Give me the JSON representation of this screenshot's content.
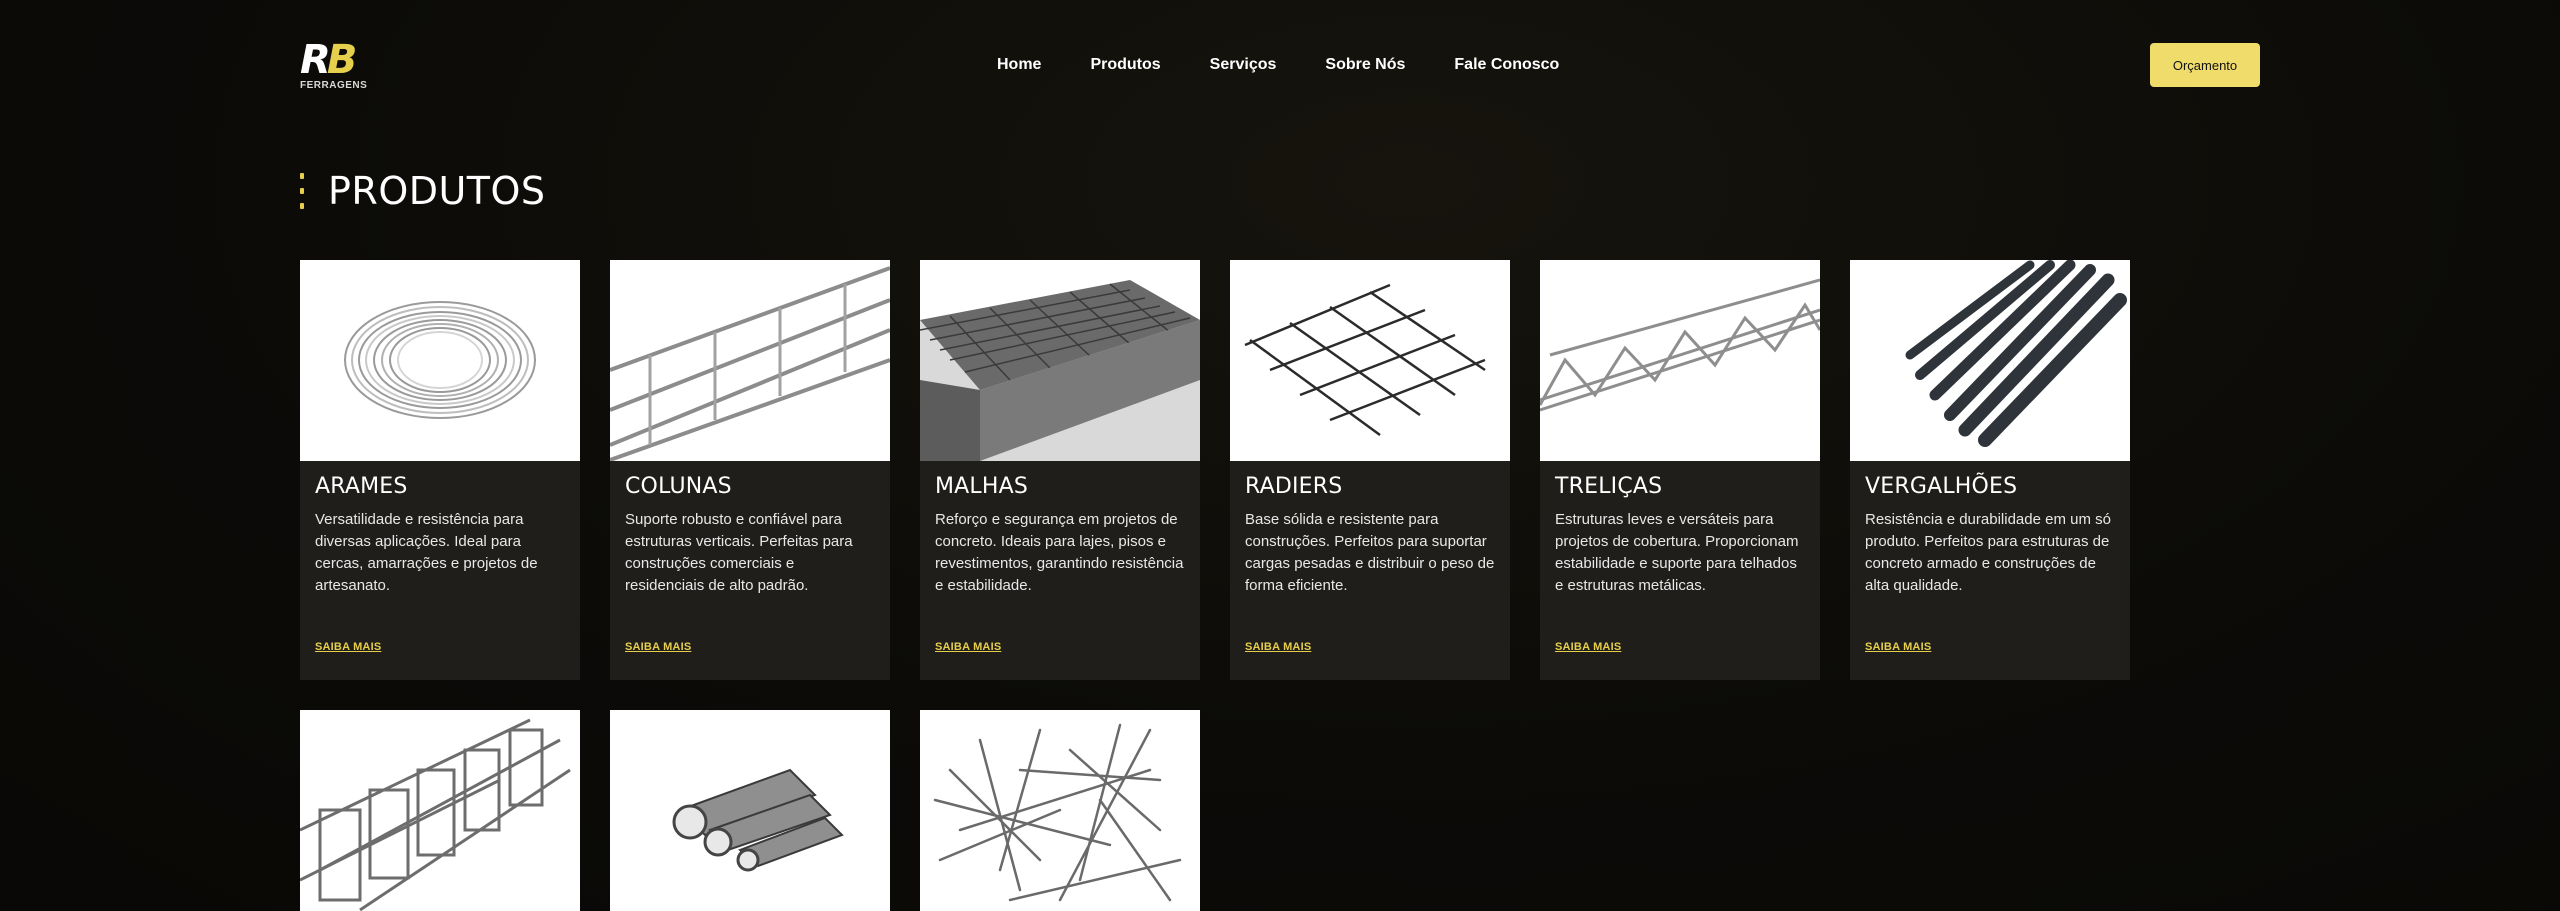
{
  "brand": {
    "mark": "RB",
    "sub": "FERRAGENS"
  },
  "nav": [
    "Home",
    "Produtos",
    "Serviços",
    "Sobre Nós",
    "Fale Conosco"
  ],
  "cta": "Orçamento",
  "section_title": "PRODUTOS",
  "products": [
    {
      "name": "ARAMES",
      "desc": "Versatilidade e resistência para diversas aplicações. Ideal para cercas, amarrações e projetos de artesanato.",
      "link": "SAIBA MAIS"
    },
    {
      "name": "COLUNAS",
      "desc": "Suporte robusto e confiável para estruturas verticais. Perfeitas para construções comerciais e residenciais de alto padrão.",
      "link": "SAIBA MAIS"
    },
    {
      "name": "MALHAS",
      "desc": "Reforço e segurança em projetos de concreto. Ideais para lajes, pisos e revestimentos, garantindo resistência e estabilidade.",
      "link": "SAIBA MAIS"
    },
    {
      "name": "RADIERS",
      "desc": "Base sólida e resistente para construções. Perfeitos para suportar cargas pesadas e distribuir o peso de forma eficiente.",
      "link": "SAIBA MAIS"
    },
    {
      "name": "TRELIÇAS",
      "desc": "Estruturas leves e versáteis para projetos de cobertura. Proporcionam estabilidade e suporte para telhados e estruturas metálicas.",
      "link": "SAIBA MAIS"
    },
    {
      "name": "VERGALHÕES",
      "desc": "Resistência e durabilidade em um só produto. Perfeitos para estruturas de concreto armado e construções de alta qualidade.",
      "link": "SAIBA MAIS"
    }
  ],
  "icons": {
    "row1": [
      "wire-coil-image",
      "column-cage-image",
      "mesh-image",
      "radier-grid-image",
      "truss-image",
      "rebar-image"
    ],
    "row2": [
      "stirrup-cage-image",
      "steel-pipes-image",
      "nails-image"
    ]
  },
  "colors": {
    "accent": "#e6cf4d",
    "cta": "#f0dc6a",
    "card": "#1f1e1b",
    "bg": "#0c0b08"
  }
}
